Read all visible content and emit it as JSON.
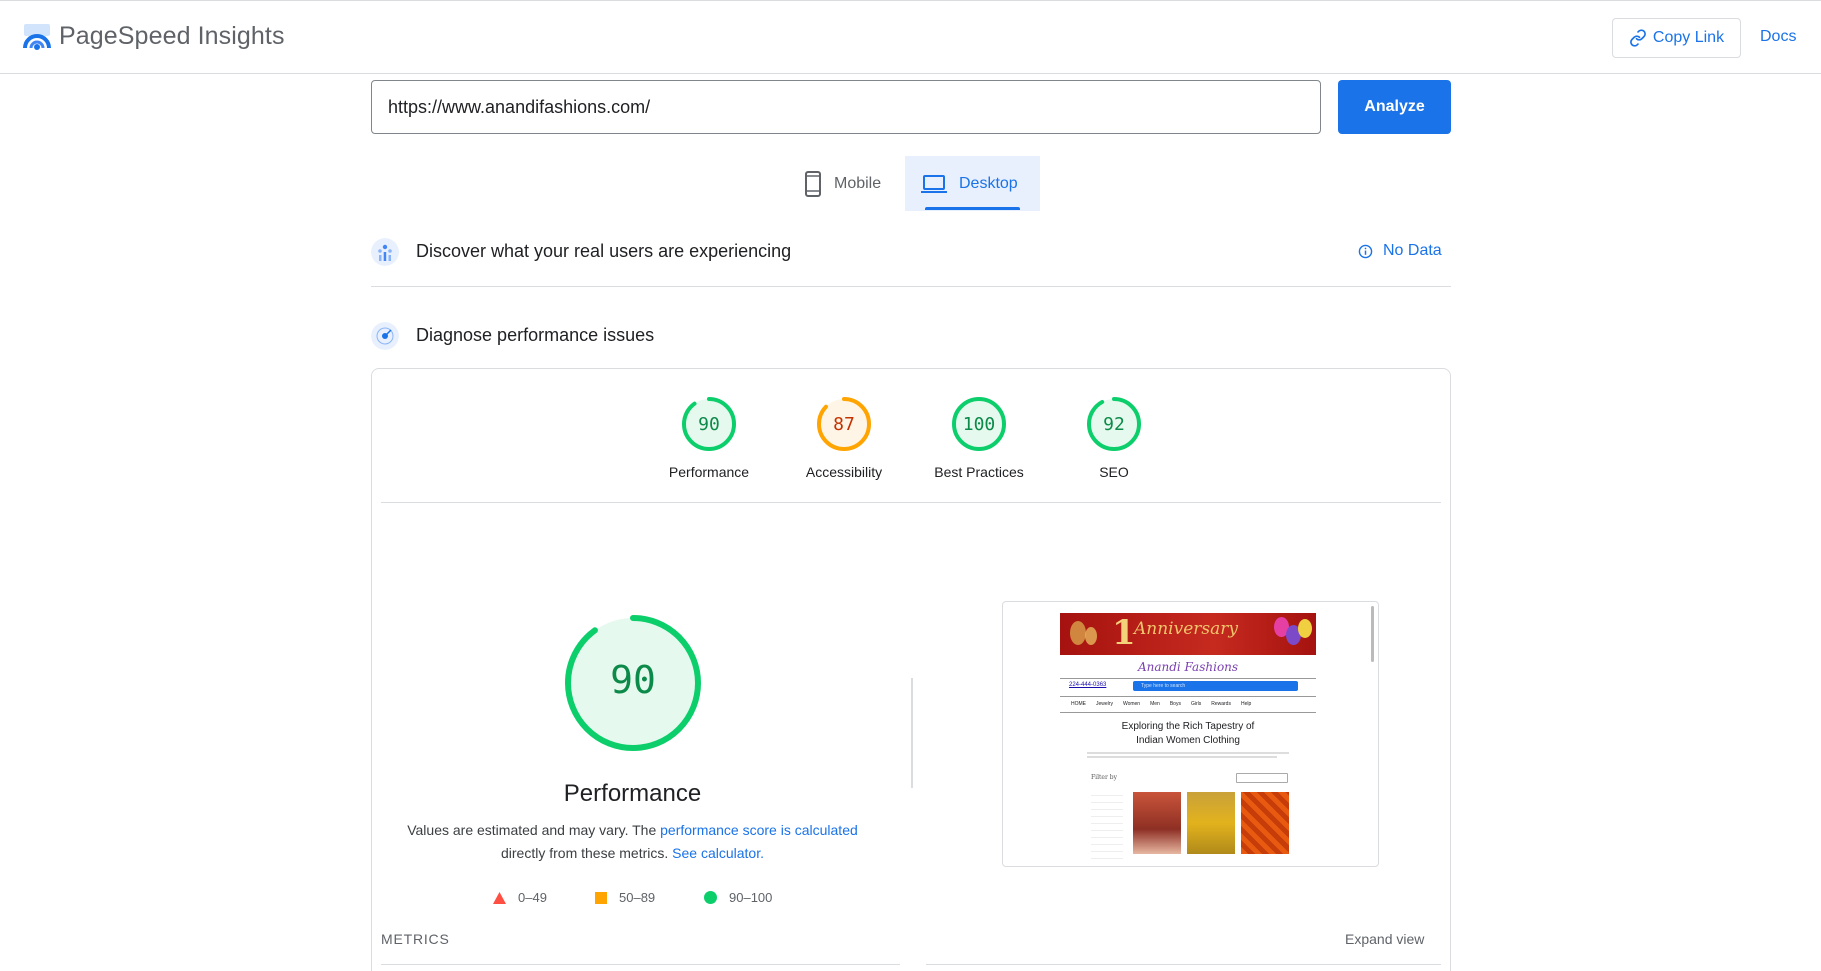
{
  "header": {
    "brand": "PageSpeed Insights",
    "copy_link_label": "Copy Link",
    "docs_label": "Docs",
    "link_icon": "link-icon"
  },
  "search": {
    "url_value": "https://www.anandifashions.com/",
    "analyze_label": "Analyze"
  },
  "device_tabs": [
    {
      "label": "Mobile",
      "icon": "phone-icon",
      "selected": false
    },
    {
      "label": "Desktop",
      "icon": "laptop-icon",
      "selected": true
    }
  ],
  "field_data": {
    "title": "Discover what your real users are experiencing",
    "status_label": "No Data",
    "status_icon": "info-icon"
  },
  "lab_data": {
    "title": "Diagnose performance issues",
    "scores": [
      {
        "label": "Performance",
        "value": "90",
        "color": "#0cce6b"
      },
      {
        "label": "Accessibility",
        "value": "87",
        "color": "#ffa400"
      },
      {
        "label": "Best Practices",
        "value": "100",
        "color": "#0cce6b"
      },
      {
        "label": "SEO",
        "value": "92",
        "color": "#0cce6b"
      }
    ],
    "main_score": {
      "value": "90",
      "label": "Performance",
      "color": "#0cce6b",
      "fraction": 0.9
    },
    "note": {
      "prefix": "Values are estimated and may vary. The ",
      "link1": "performance score is calculated",
      "middle": "directly from these metrics. ",
      "link2": "See calculator."
    },
    "legend": [
      {
        "range": "0–49",
        "shape": "triangle",
        "color": "#ff4e42"
      },
      {
        "range": "50–89",
        "shape": "square",
        "color": "#ffa400"
      },
      {
        "range": "90–100",
        "shape": "circle",
        "color": "#0cce6b"
      }
    ],
    "metrics_label": "METRICS",
    "expand_label": "Expand view"
  },
  "preview": {
    "phone": "224-444-0363",
    "search_placeholder": "Type here to search",
    "headline_line1": "Exploring the Rich Tapestry of",
    "headline_line2": "Indian Women Clothing",
    "nav": [
      "HOME",
      "Jewelry",
      "Women",
      "Men",
      "Boys",
      "Girls",
      "Rewards",
      "Help"
    ],
    "filter_label": "Filter by"
  },
  "colors": {
    "accent": "#1a73e8",
    "pass": "#0cce6b",
    "average": "#ffa400",
    "fail": "#ff4e42"
  }
}
